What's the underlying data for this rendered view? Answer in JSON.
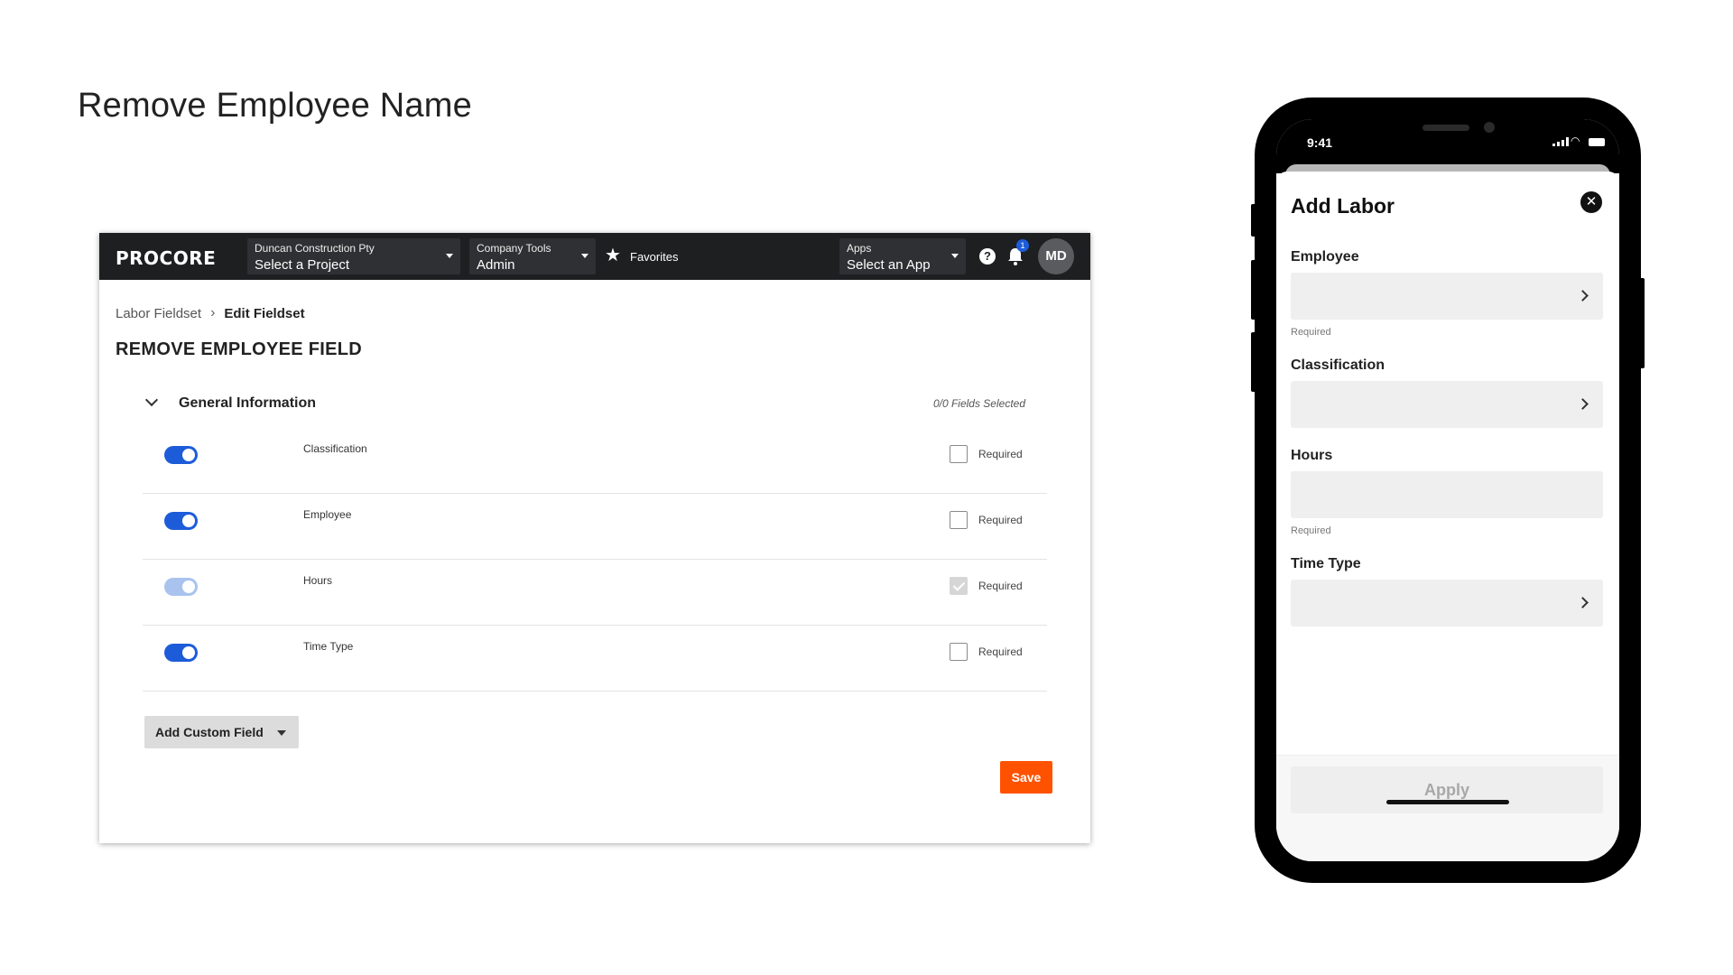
{
  "slide": {
    "title": "Remove Employee Name"
  },
  "web": {
    "nav": {
      "logo": "PROCORE",
      "project": {
        "label": "Duncan Construction Pty",
        "value": "Select a Project"
      },
      "tools": {
        "label": "Company Tools",
        "value": "Admin"
      },
      "favorites": "Favorites",
      "apps": {
        "label": "Apps",
        "value": "Select an App"
      },
      "help": "?",
      "notifications_count": "1",
      "avatar_initials": "MD",
      "icons": [
        "star-icon",
        "help-icon",
        "bell-icon"
      ]
    },
    "breadcrumb": {
      "parent": "Labor Fieldset",
      "current": "Edit Fieldset"
    },
    "page_title": "REMOVE EMPLOYEE FIELD",
    "section": {
      "title": "General Information",
      "count": "0/0 Fields Selected"
    },
    "rows": [
      {
        "label": "Classification",
        "enabled": true,
        "required": false,
        "required_label": "Required"
      },
      {
        "label": "Employee",
        "enabled": true,
        "required": false,
        "required_label": "Required"
      },
      {
        "label": "Hours",
        "enabled": true,
        "disabled": true,
        "required": true,
        "required_label": "Required"
      },
      {
        "label": "Time Type",
        "enabled": true,
        "required": false,
        "required_label": "Required"
      }
    ],
    "add_custom_field": "Add Custom Field",
    "save": "Save",
    "colors": {
      "nav_bg": "#1e1f21",
      "toggle_on": "#1d5cd9",
      "save_bg": "#ff5200"
    }
  },
  "mobile": {
    "status_time": "9:41",
    "title": "Add Labor",
    "fields": [
      {
        "label": "Employee",
        "hint": "Required",
        "chevron": true
      },
      {
        "label": "Classification",
        "hint": "",
        "chevron": true
      },
      {
        "label": "Hours",
        "hint": "Required",
        "chevron": false
      },
      {
        "label": "Time Type",
        "hint": "",
        "chevron": true
      }
    ],
    "apply": "Apply"
  }
}
